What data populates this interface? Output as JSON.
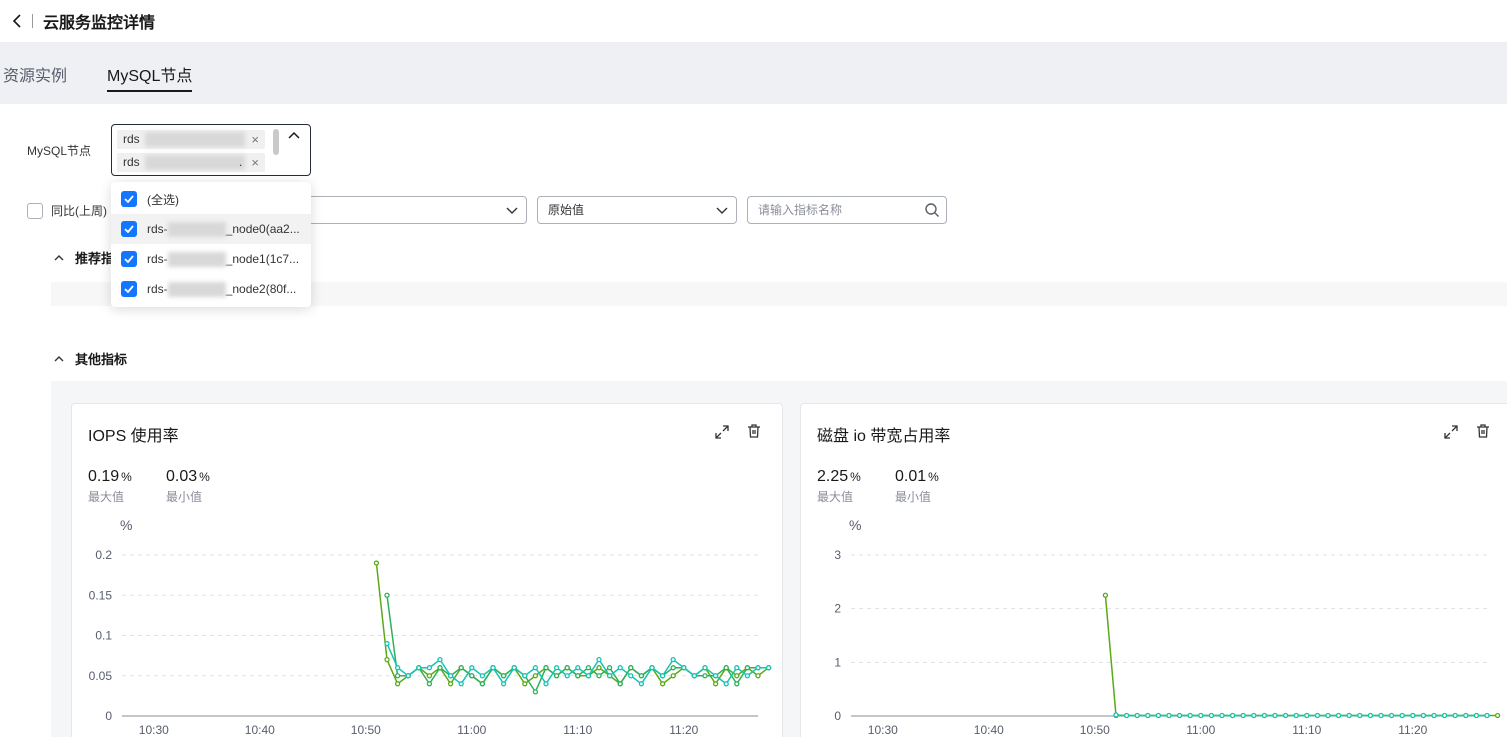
{
  "header": {
    "title": "云服务监控详情"
  },
  "tabs": [
    {
      "label": "资源实例",
      "active": false
    },
    {
      "label": "MySQL节点",
      "active": true
    }
  ],
  "filter": {
    "node_label": "MySQL节点",
    "selected_tags": [
      "rds",
      "rds"
    ],
    "tag_trailing": [
      "",
      "."
    ],
    "dropdown": {
      "select_all": "(全选)",
      "items": [
        {
          "prefix": "rds-",
          "suffix": "_node0(aa2..."
        },
        {
          "prefix": "rds-",
          "suffix": "_node1(1c7..."
        },
        {
          "prefix": "rds-",
          "suffix": "_node2(80f..."
        }
      ]
    },
    "compare_label": "同比(上周)",
    "value_select": "原始值",
    "search_placeholder": "请输入指标名称"
  },
  "sections": {
    "recommended": "推荐指",
    "other": "其他指标"
  },
  "colors": {
    "accent": "#1476ff",
    "series_green": "#5aaa15",
    "series_teal": "#16c3b4"
  },
  "cards": [
    {
      "title": "IOPS 使用率",
      "max": {
        "value": "0.19",
        "unit": "%",
        "label": "最大值"
      },
      "min": {
        "value": "0.03",
        "unit": "%",
        "label": "最小值"
      }
    },
    {
      "title": "磁盘 io 带宽占用率",
      "max": {
        "value": "2.25",
        "unit": "%",
        "label": "最大值"
      },
      "min": {
        "value": "0.01",
        "unit": "%",
        "label": "最小值"
      }
    }
  ],
  "chart_data": [
    {
      "type": "line",
      "ylabel": "%",
      "ylim": [
        0,
        0.2
      ],
      "yticks": [
        "0",
        "0.05",
        "0.1",
        "0.15",
        "0.2"
      ],
      "xticks": [
        "10:30",
        "10:40",
        "10:50",
        "11:00",
        "11:10",
        "11:20"
      ],
      "x_minutes_range": [
        10.27,
        11.27
      ],
      "series": [
        {
          "color": "#5aaa15",
          "x_start": "10:51",
          "values": [
            0.19,
            0.07,
            0.04,
            0.05,
            0.06,
            0.05,
            0.06,
            0.04,
            0.06,
            0.05,
            0.04,
            0.06,
            0.05,
            0.06,
            0.04,
            0.05,
            0.06,
            0.05,
            0.06,
            0.05,
            0.05,
            0.06,
            0.05,
            0.04,
            0.06,
            0.05,
            0.06,
            0.04,
            0.05,
            0.06,
            0.05,
            0.06,
            0.04,
            0.06,
            0.05,
            0.06,
            0.05,
            0.06
          ]
        },
        {
          "color": "#2eb05a",
          "x_start": "10:52",
          "values": [
            0.15,
            0.05,
            0.05,
            0.06,
            0.04,
            0.06,
            0.05,
            0.06,
            0.05,
            0.04,
            0.06,
            0.05,
            0.06,
            0.05,
            0.03,
            0.06,
            0.05,
            0.06,
            0.05,
            0.06,
            0.05,
            0.06,
            0.04,
            0.06,
            0.05,
            0.06,
            0.05,
            0.06,
            0.06,
            0.05,
            0.05,
            0.05,
            0.06,
            0.04,
            0.06,
            0.06,
            0.06
          ]
        },
        {
          "color": "#16c3b4",
          "x_start": "10:52",
          "values": [
            0.09,
            0.06,
            0.05,
            0.06,
            0.06,
            0.07,
            0.05,
            0.04,
            0.06,
            0.05,
            0.06,
            0.04,
            0.06,
            0.05,
            0.06,
            0.04,
            0.06,
            0.05,
            0.06,
            0.05,
            0.07,
            0.05,
            0.06,
            0.05,
            0.04,
            0.06,
            0.05,
            0.07,
            0.06,
            0.05,
            0.06,
            0.05,
            0.04,
            0.06,
            0.05,
            0.06,
            0.06
          ]
        }
      ]
    },
    {
      "type": "line",
      "ylabel": "%",
      "ylim": [
        0,
        3
      ],
      "yticks": [
        "0",
        "1",
        "2",
        "3"
      ],
      "xticks": [
        "10:30",
        "10:40",
        "10:50",
        "11:00",
        "11:10",
        "11:20"
      ],
      "series": [
        {
          "color": "#5aaa15",
          "x_start": "10:51",
          "values": [
            2.25,
            0.01,
            0.01,
            0.01,
            0.01,
            0.01,
            0.01,
            0.01,
            0.01,
            0.01,
            0.01,
            0.01,
            0.01,
            0.01,
            0.01,
            0.01,
            0.01,
            0.01,
            0.01,
            0.01,
            0.01,
            0.01,
            0.01,
            0.01,
            0.01,
            0.01,
            0.01,
            0.01,
            0.01,
            0.01,
            0.01,
            0.01,
            0.01,
            0.01,
            0.01,
            0.01,
            0.01,
            0.01
          ]
        },
        {
          "color": "#16c3b4",
          "x_start": "10:52",
          "values": [
            0.02,
            0.01,
            0.01,
            0.01,
            0.01,
            0.01,
            0.01,
            0.01,
            0.01,
            0.01,
            0.01,
            0.01,
            0.01,
            0.01,
            0.01,
            0.01,
            0.01,
            0.01,
            0.01,
            0.01,
            0.01,
            0.01,
            0.01,
            0.01,
            0.01,
            0.01,
            0.01,
            0.01,
            0.01,
            0.01,
            0.01,
            0.01,
            0.01,
            0.01,
            0.01,
            0.01
          ]
        }
      ]
    }
  ]
}
